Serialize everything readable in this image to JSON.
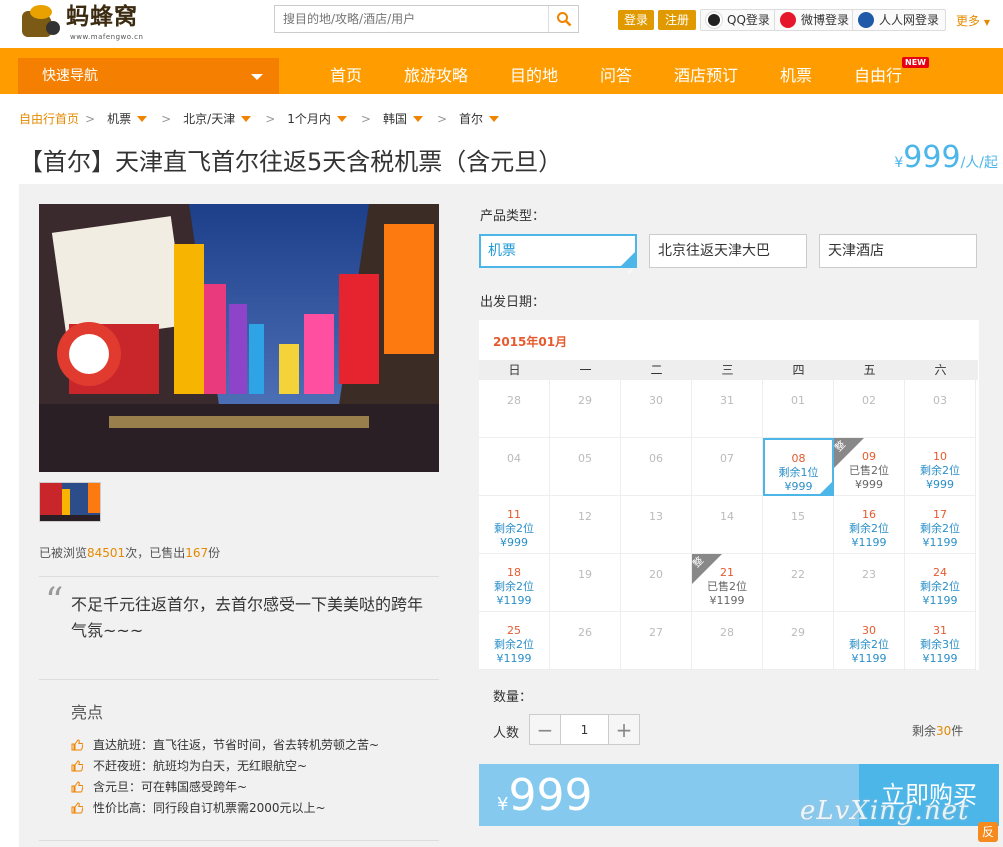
{
  "header": {
    "logo_text": "蚂蜂窝",
    "logo_url": "www.mafengwo.cn",
    "search_placeholder": "搜目的地/攻略/酒店/用户",
    "login_label": "登录",
    "register_label": "注册",
    "qq_login": "QQ登录",
    "weibo_login": "微博登录",
    "renren_login": "人人网登录",
    "more_label": "更多"
  },
  "nav": {
    "quick_nav": "快速导航",
    "items": [
      "首页",
      "旅游攻略",
      "目的地",
      "问答",
      "酒店预订",
      "机票",
      "自由行"
    ],
    "new_badge": "NEW"
  },
  "breadcrumbs": [
    "自由行首页",
    "机票",
    "北京/天津",
    "1个月内",
    "韩国",
    "首尔"
  ],
  "product": {
    "title": "【首尔】天津直飞首尔往返5天含税机票（含元旦）",
    "price_currency": "¥",
    "price": "999",
    "price_unit": "/人/起",
    "views_prefix": "已被浏览",
    "views": "84501",
    "views_suffix": "次，已售出",
    "sold": "167",
    "sold_suffix": "份",
    "quote": "不足千元往返首尔，去首尔感受一下美美哒的跨年气氛~~~",
    "highlights_title": "亮点",
    "highlights": [
      "直达航班：直飞往返，节省时间，省去转机劳顿之苦~",
      "不赶夜班：航班均为白天，无红眼航空~",
      "含元旦：可在韩国感受跨年~",
      "性价比高：同行段自订机票需2000元以上~"
    ]
  },
  "booking": {
    "type_label": "产品类型：",
    "types": [
      "机票",
      "北京往返天津大巴",
      "天津酒店"
    ],
    "date_label": "出发日期：",
    "month": "2015年01月",
    "weekdays": [
      "日",
      "一",
      "二",
      "三",
      "四",
      "五",
      "六"
    ],
    "days": [
      {
        "d": "28",
        "t": "out"
      },
      {
        "d": "29",
        "t": "out"
      },
      {
        "d": "30",
        "t": "out"
      },
      {
        "d": "31",
        "t": "out"
      },
      {
        "d": "01",
        "t": "dim"
      },
      {
        "d": "02",
        "t": "dim"
      },
      {
        "d": "03",
        "t": "dim"
      },
      {
        "d": "04",
        "t": "dim"
      },
      {
        "d": "05",
        "t": "dim"
      },
      {
        "d": "06",
        "t": "dim"
      },
      {
        "d": "07",
        "t": "dim"
      },
      {
        "d": "08",
        "t": "avail",
        "s": "剩余1位",
        "p": "¥999",
        "cur": true
      },
      {
        "d": "09",
        "t": "sold",
        "s": "已售2位",
        "p": "¥999",
        "tag": "整"
      },
      {
        "d": "10",
        "t": "avail",
        "s": "剩余2位",
        "p": "¥999"
      },
      {
        "d": "11",
        "t": "avail",
        "s": "剩余2位",
        "p": "¥999"
      },
      {
        "d": "12",
        "t": "dim"
      },
      {
        "d": "13",
        "t": "dim"
      },
      {
        "d": "14",
        "t": "dim"
      },
      {
        "d": "15",
        "t": "dim"
      },
      {
        "d": "16",
        "t": "avail",
        "s": "剩余2位",
        "p": "¥1199"
      },
      {
        "d": "17",
        "t": "avail",
        "s": "剩余2位",
        "p": "¥1199"
      },
      {
        "d": "18",
        "t": "avail",
        "s": "剩余2位",
        "p": "¥1199"
      },
      {
        "d": "19",
        "t": "dim"
      },
      {
        "d": "20",
        "t": "dim"
      },
      {
        "d": "21",
        "t": "sold",
        "s": "已售2位",
        "p": "¥1199",
        "tag": "整"
      },
      {
        "d": "22",
        "t": "dim"
      },
      {
        "d": "23",
        "t": "dim"
      },
      {
        "d": "24",
        "t": "avail",
        "s": "剩余2位",
        "p": "¥1199"
      },
      {
        "d": "25",
        "t": "avail",
        "s": "剩余2位",
        "p": "¥1199"
      },
      {
        "d": "26",
        "t": "dim"
      },
      {
        "d": "27",
        "t": "dim"
      },
      {
        "d": "28",
        "t": "dim"
      },
      {
        "d": "29",
        "t": "dim"
      },
      {
        "d": "30",
        "t": "avail",
        "s": "剩余2位",
        "p": "¥1199"
      },
      {
        "d": "31",
        "t": "avail",
        "s": "剩余3位",
        "p": "¥1199"
      }
    ],
    "qty_label": "数量：",
    "people_label": "人数",
    "qty_value": "1",
    "remain_prefix": "剩余",
    "remain": "30",
    "remain_suffix": "件",
    "buy_currency": "¥",
    "buy_price": "999",
    "buy_label": "立即购买"
  },
  "watermark": "eLvXing.net",
  "colors": {
    "accent": "#ff9d00",
    "blue": "#4db6e9",
    "red": "#e65a2e"
  }
}
